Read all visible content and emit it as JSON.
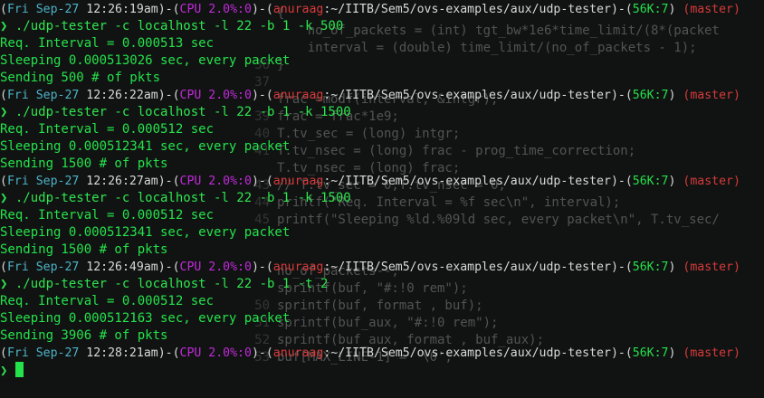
{
  "background_code": [
    {
      "ln": "",
      "text": "{"
    },
    {
      "ln": "",
      "text": "    no_of_packets = (int) tgt_bw*1e6*time_limit/(8*(packet"
    },
    {
      "ln": "",
      "text": "    interval = (double) time_limit/(no_of_packets - 1);"
    },
    {
      "ln": "36",
      "text": "}"
    },
    {
      "ln": "37",
      "text": ""
    },
    {
      "ln": "",
      "text": "frac =modf(interval, &intgr);"
    },
    {
      "ln": "39",
      "text": "frac = frac*1e9;"
    },
    {
      "ln": "40",
      "text": "T.tv_sec = (long) intgr;"
    },
    {
      "ln": "41",
      "text": "T.tv_nsec = (long) frac - prog_time_correction;"
    },
    {
      "ln": "",
      "text": "T.tv_nsec = (long) frac;"
    },
    {
      "ln": "43",
      "text": "// T.tv_sec = 0;T.tv_nsec = 0;"
    },
    {
      "ln": "44",
      "text": "printf(\"Req. Interval = %f sec\\n\", interval);"
    },
    {
      "ln": "45",
      "text": "printf(\"Sleeping %ld.%09ld sec, every packet\\n\", T.tv_sec/"
    },
    {
      "ln": "",
      "text": ""
    },
    {
      "ln": "",
      "text": ""
    },
    {
      "ln": "",
      "text": "no_of_packets--;"
    },
    {
      "ln": "",
      "text": "sprintf(buf, \"#:!0 rem\");"
    },
    {
      "ln": "50",
      "text": "sprintf(buf, format , buf);"
    },
    {
      "ln": "51",
      "text": "sprintf(buf_aux, \"#:!0 rem\");"
    },
    {
      "ln": "52",
      "text": "sprintf(buf_aux, format , buf_aux);"
    },
    {
      "ln": "53",
      "text": "buf[MAX_LINE-1] = '\\0';"
    }
  ],
  "terminal": {
    "blocks": [
      {
        "prompt": {
          "day": "Fri",
          "date": "Sep-27",
          "time": "12:26:19am",
          "cpu": "CPU 2.0%:0",
          "user": "anuraag",
          "path": "~/IITB/Sem5/ovs-examples/aux/udp-tester",
          "mem": "56K:7",
          "branch": "master"
        },
        "command": "./udp-tester -c localhost -l 22 -b 1 -k 500",
        "output": [
          "Req. Interval = 0.000513 sec",
          "Sleeping 0.000513026 sec, every packet",
          "Sending 500 # of pkts"
        ]
      },
      {
        "prompt": {
          "day": "Fri",
          "date": "Sep-27",
          "time": "12:26:22am",
          "cpu": "CPU 2.0%:0",
          "user": "anuraag",
          "path": "~/IITB/Sem5/ovs-examples/aux/udp-tester",
          "mem": "56K:7",
          "branch": "master"
        },
        "command": "./udp-tester -c localhost -l 22 -b 1 -k 1500",
        "output": [
          "Req. Interval = 0.000512 sec",
          "Sleeping 0.000512341 sec, every packet",
          "Sending 1500 # of pkts"
        ]
      },
      {
        "prompt": {
          "day": "Fri",
          "date": "Sep-27",
          "time": "12:26:27am",
          "cpu": "CPU 2.0%:0",
          "user": "anuraag",
          "path": "~/IITB/Sem5/ovs-examples/aux/udp-tester",
          "mem": "56K:7",
          "branch": "master"
        },
        "command": "./udp-tester -c localhost -l 22 -b 1 -k 1500",
        "output": [
          "Req. Interval = 0.000512 sec",
          "Sleeping 0.000512341 sec, every packet",
          "Sending 1500 # of pkts"
        ]
      },
      {
        "prompt": {
          "day": "Fri",
          "date": "Sep-27",
          "time": "12:26:49am",
          "cpu": "CPU 2.0%:0",
          "user": "anuraag",
          "path": "~/IITB/Sem5/ovs-examples/aux/udp-tester",
          "mem": "56K:7",
          "branch": "master"
        },
        "command": "./udp-tester -c localhost -l 22 -b 1 -t 2",
        "output": [
          "Req. Interval = 0.000512 sec",
          "Sleeping 0.000512163 sec, every packet",
          "Sending 3906 # of pkts"
        ]
      },
      {
        "prompt": {
          "day": "Fri",
          "date": "Sep-27",
          "time": "12:28:21am",
          "cpu": "CPU 2.0%:0",
          "user": "anuraag",
          "path": "~/IITB/Sem5/ovs-examples/aux/udp-tester",
          "mem": "56K:7",
          "branch": "master"
        },
        "command": "",
        "output": []
      }
    ],
    "prompt_symbol": "❯"
  },
  "colors": {
    "background": "#111313",
    "prompt_cyan": "#4db2c6",
    "prompt_green": "#24e24a",
    "prompt_purple": "#c02ad8",
    "prompt_red": "#d83a3a",
    "output_green": "#24e24a"
  }
}
